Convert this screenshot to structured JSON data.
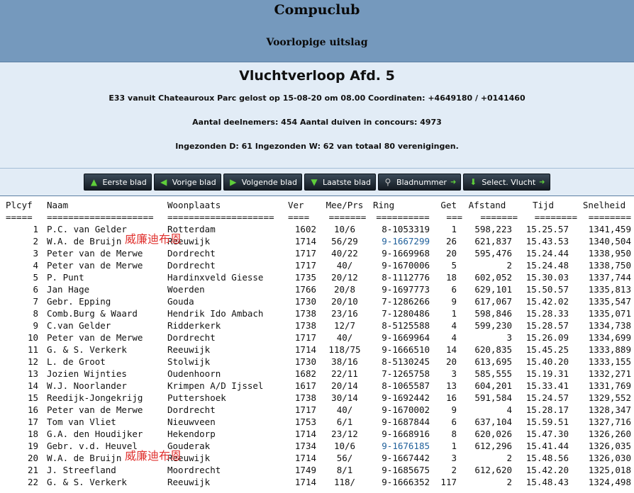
{
  "header": {
    "title": "Compuclub",
    "subtitle": "Voorlopige uitslag"
  },
  "info": {
    "heading": "Vluchtverloop Afd. 5",
    "line1": "E33 vanuit Chateauroux Parc gelost op 15-08-20 om 08.00 Coordinaten: +4649180 / +0141460",
    "line2": "Aantal deelnemers: 454 Aantal duiven in concours: 4973",
    "line3": "Ingezonden D: 61 Ingezonden W: 62 van totaal 80 verenigingen."
  },
  "nav": {
    "first": "Eerste blad",
    "prev": "Vorige blad",
    "next": "Volgende blad",
    "last": "Laatste blad",
    "page": "Bladnummer",
    "select": "Select. Vlucht"
  },
  "table": {
    "headers": [
      "Plcyf",
      "Naam",
      "Woonplaats",
      "Ver",
      "Mee/Prs",
      "Ring",
      "Get",
      "Afstand",
      "Tijd",
      "Snelheid"
    ],
    "separators": [
      "=====",
      "====================",
      "====================",
      "====",
      "=======",
      "==========",
      "===",
      "=======",
      "========",
      "========"
    ],
    "watermark": "威廉迪布恩",
    "rows": [
      [
        "1",
        "P.C. van Gelder",
        "Rotterdam",
        "1602",
        "10/6",
        "8-1053319",
        "1",
        "598,223",
        "15.25.57",
        "1341,459"
      ],
      [
        "2",
        "W.A. de Bruijn",
        "Reeuwijk",
        "1714",
        "56/29",
        "9-1667299",
        "26",
        "621,837",
        "15.43.53",
        "1340,504"
      ],
      [
        "3",
        "Peter van de Merwe",
        "Dordrecht",
        "1717",
        "40/22",
        "9-1669968",
        "20",
        "595,476",
        "15.24.44",
        "1338,950"
      ],
      [
        "4",
        "Peter van de Merwe",
        "Dordrecht",
        "1717",
        "40/",
        "9-1670006",
        "5",
        "2",
        "15.24.48",
        "1338,750"
      ],
      [
        "5",
        "P. Punt",
        "Hardinxveld Giesse",
        "1735",
        "20/12",
        "8-1112776",
        "18",
        "602,052",
        "15.30.03",
        "1337,744"
      ],
      [
        "6",
        "Jan Hage",
        "Woerden",
        "1766",
        "20/8",
        "9-1697773",
        "6",
        "629,101",
        "15.50.57",
        "1335,813"
      ],
      [
        "7",
        "Gebr. Epping",
        "Gouda",
        "1730",
        "20/10",
        "7-1286266",
        "9",
        "617,067",
        "15.42.02",
        "1335,547"
      ],
      [
        "8",
        "Comb.Burg & Waard",
        "Hendrik Ido Ambach",
        "1738",
        "23/16",
        "7-1280486",
        "1",
        "598,846",
        "15.28.33",
        "1335,071"
      ],
      [
        "9",
        "C.van Gelder",
        "Ridderkerk",
        "1738",
        "12/7",
        "8-5125588",
        "4",
        "599,230",
        "15.28.57",
        "1334,738"
      ],
      [
        "10",
        "Peter van de Merwe",
        "Dordrecht",
        "1717",
        "40/",
        "9-1669964",
        "4",
        "3",
        "15.26.09",
        "1334,699"
      ],
      [
        "11",
        "G. & S. Verkerk",
        "Reeuwijk",
        "1714",
        "118/75",
        "9-1666510",
        "14",
        "620,835",
        "15.45.25",
        "1333,889"
      ],
      [
        "12",
        "L. de Groot",
        "Stolwijk",
        "1730",
        "38/16",
        "8-5130245",
        "20",
        "613,695",
        "15.40.20",
        "1333,155"
      ],
      [
        "13",
        "Jozien Wijnties",
        "Oudenhoorn",
        "1682",
        "22/11",
        "7-1265758",
        "3",
        "585,555",
        "15.19.31",
        "1332,271"
      ],
      [
        "14",
        "W.J. Noorlander",
        "Krimpen A/D Ijssel",
        "1617",
        "20/14",
        "8-1065587",
        "13",
        "604,201",
        "15.33.41",
        "1331,769"
      ],
      [
        "15",
        "Reedijk-Jongekrijg",
        "Puttershoek",
        "1738",
        "30/14",
        "9-1692442",
        "16",
        "591,584",
        "15.24.57",
        "1329,552"
      ],
      [
        "16",
        "Peter van de Merwe",
        "Dordrecht",
        "1717",
        "40/",
        "9-1670002",
        "9",
        "4",
        "15.28.17",
        "1328,347"
      ],
      [
        "17",
        "Tom van Vliet",
        "Nieuwveen",
        "1753",
        "6/1",
        "9-1687844",
        "6",
        "637,104",
        "15.59.51",
        "1327,716"
      ],
      [
        "18",
        "G.A. den Houdijker",
        "Hekendorp",
        "1714",
        "23/12",
        "9-1668916",
        "8",
        "620,026",
        "15.47.30",
        "1326,260"
      ],
      [
        "19",
        "Gebr. v.d. Heuvel",
        "Gouderak",
        "1734",
        "10/6",
        "9-1676185",
        "1",
        "612,296",
        "15.41.44",
        "1326,035"
      ],
      [
        "20",
        "W.A. de Bruijn",
        "Reeuwijk",
        "1714",
        "56/",
        "9-1667442",
        "3",
        "2",
        "15.48.56",
        "1326,030"
      ],
      [
        "21",
        "J. Streefland",
        "Moordrecht",
        "1749",
        "8/1",
        "9-1685675",
        "2",
        "612,620",
        "15.42.20",
        "1325,018"
      ],
      [
        "22",
        "G. & S. Verkerk",
        "Reeuwijk",
        "1714",
        "118/",
        "9-1666352",
        "117",
        "2",
        "15.48.43",
        "1324,498"
      ]
    ],
    "link_rows": [
      1,
      18
    ]
  }
}
